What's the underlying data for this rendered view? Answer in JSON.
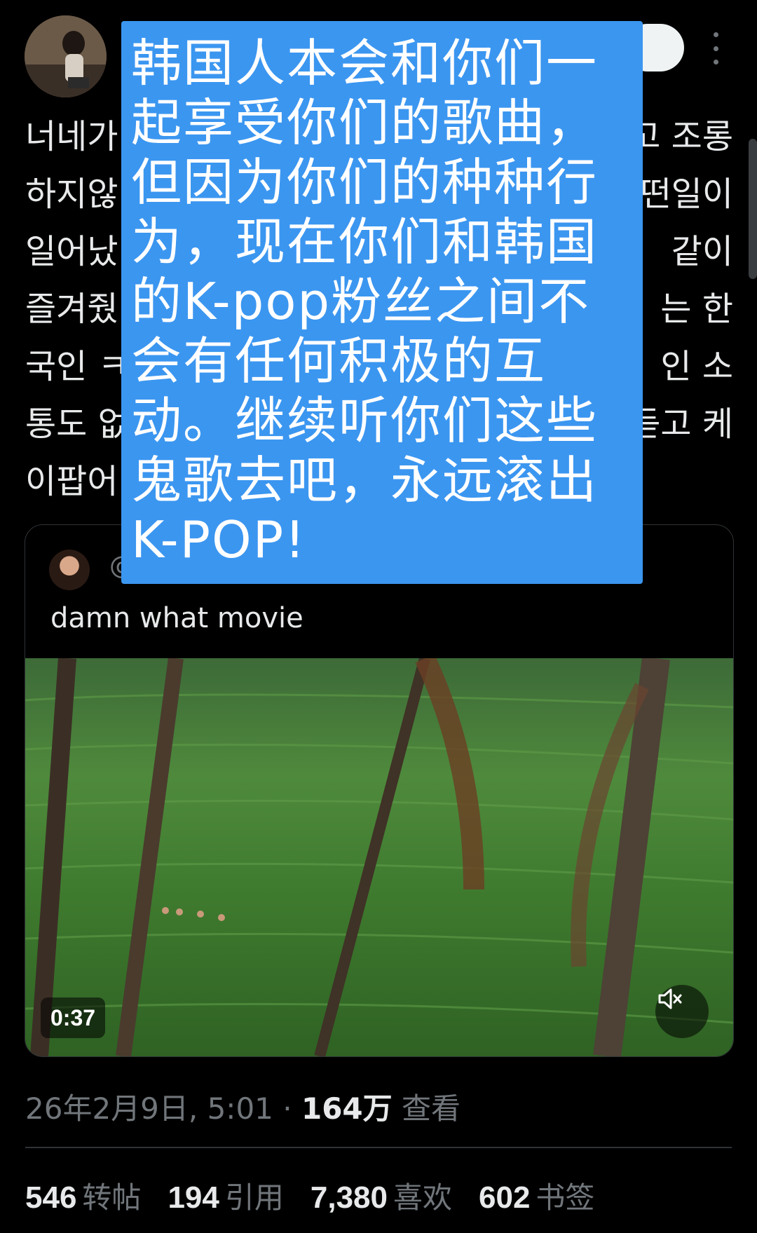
{
  "tweet": {
    "lines": [
      {
        "left": "너네가",
        "right": "고 조롱"
      },
      {
        "left": "하지않",
        "right": "떤일이"
      },
      {
        "left": "일어났",
        "right": "같이"
      },
      {
        "left": "즐겨줬",
        "right": "는 한"
      },
      {
        "left": "국인 ㅋ",
        "right": "인 소"
      },
      {
        "left": "통도 없",
        "right": "듣고 케"
      },
      {
        "left": "이팝어",
        "right": ""
      }
    ]
  },
  "overlay": {
    "lines": [
      "韩国人本会和你们一",
      "起享受你们的歌曲，",
      "但因为你们的种种行",
      "为，现在你们和韩国",
      "的K-pop粉丝之间不",
      "会有任何积极的互",
      "动。继续听你们这些",
      "鬼歌去吧，永远滚出",
      "K-POP!"
    ],
    "background": "#3b96f0"
  },
  "quote": {
    "handle": "@",
    "text": "damn what movie",
    "duration": "0:37"
  },
  "meta": {
    "date": "26年2月9日, 5:01 · ",
    "views_count": "164万",
    "views_label": " 查看"
  },
  "stats": [
    {
      "count": "546",
      "label": "转帖"
    },
    {
      "count": "194",
      "label": "引用"
    },
    {
      "count": "7,380",
      "label": "喜欢"
    },
    {
      "count": "602",
      "label": "书签"
    }
  ],
  "icons": [
    "more-icon",
    "mute-icon"
  ],
  "colors": {
    "background": "#000000",
    "text": "#e7e9ea",
    "muted": "#71767b",
    "accent": "#3b96f0"
  }
}
